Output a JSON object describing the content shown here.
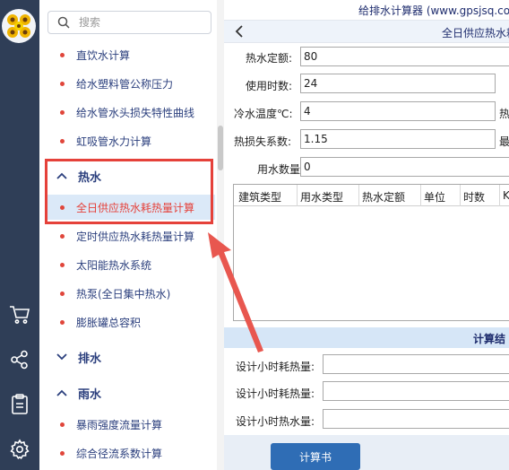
{
  "app": {
    "title": "给排水计算器 (www.gpsjsq.com)"
  },
  "search": {
    "placeholder": "搜索"
  },
  "sidebar": {
    "items_top": [
      {
        "label": "直饮水计算"
      },
      {
        "label": "给水塑料管公称压力"
      },
      {
        "label": "给水管水头损失特性曲线"
      },
      {
        "label": "虹吸管水力计算"
      }
    ],
    "group_hot": {
      "label": "热水"
    },
    "items_hot": [
      {
        "label": "全日供应热水耗热量计算",
        "active": true
      },
      {
        "label": "定时供应热水耗热量计算"
      },
      {
        "label": "太阳能热水系统"
      },
      {
        "label": "热泵(全日集中热水)"
      },
      {
        "label": "膨胀罐总容积"
      }
    ],
    "group_drain": {
      "label": "排水"
    },
    "group_rain": {
      "label": "雨水"
    },
    "items_rain": [
      {
        "label": "暴雨强度流量计算"
      },
      {
        "label": "综合径流系数计算"
      }
    ]
  },
  "rail_icons": [
    "cart-icon",
    "share-icon",
    "clipboard-icon",
    "settings-icon"
  ],
  "page": {
    "title": "全日供应热水耗热"
  },
  "form": {
    "quota_label": "热水定额:",
    "quota_value": "80",
    "hours_label": "使用时数:",
    "hours_value": "24",
    "cold_temp_label": "冷水温度℃:",
    "cold_temp_value": "4",
    "cold_temp_suffix": "热",
    "heat_loss_label": "热损失系数:",
    "heat_loss_value": "1.15",
    "heat_loss_suffix": "最",
    "users_label": "用水数量:",
    "users_value": "0"
  },
  "table": {
    "headers": [
      "建筑类型",
      "用水类型",
      "热水定额",
      "单位",
      "时数",
      "K"
    ]
  },
  "results": {
    "section_label": "计算结",
    "max_hour_heat_label": "设计小时耗热量:",
    "max_hour_heat2_label": "设计小时耗热量:",
    "max_hour_water_label": "设计小时热水量:"
  },
  "buttons": {
    "calc_book": "计算书"
  },
  "colors": {
    "rail": "#2f3e57",
    "accent": "#2f6db5",
    "highlight": "#e5413a",
    "active_bg": "#dbe9f8"
  }
}
